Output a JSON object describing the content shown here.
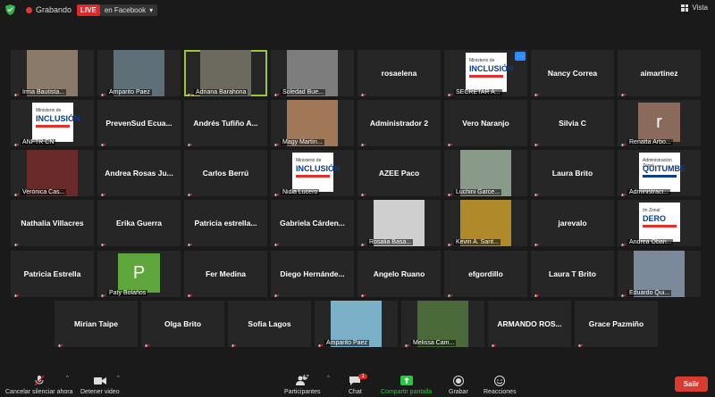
{
  "topbar": {
    "recording_label": "Grabando",
    "live_label": "LIVE",
    "live_destination": "en Facebook",
    "view_label": "Vista"
  },
  "tiles": [
    {
      "name": "Irma Bautista...",
      "style": "photo",
      "bg": "#8a7a6a"
    },
    {
      "name": "Amparito Paez",
      "style": "photo",
      "bg": "#5e6f78"
    },
    {
      "name": "Adriana Barahona",
      "style": "photo",
      "bg": "#6c6a5e",
      "active": true
    },
    {
      "name": "Soledad Bue...",
      "style": "photo",
      "bg": "#7d7d7d"
    },
    {
      "name": "rosaelena",
      "style": "text"
    },
    {
      "name": "SECRETAR A...",
      "style": "logo",
      "logo": "inclusion",
      "more": true
    },
    {
      "name": "Nancy Correa",
      "style": "text"
    },
    {
      "name": "aimartinez",
      "style": "text"
    },
    {
      "name": "ANFTR CN",
      "style": "logo",
      "logo": "inclusion"
    },
    {
      "name": "PrevenSud Ecua...",
      "style": "text"
    },
    {
      "name": "Andrés Tufiño A...",
      "style": "text"
    },
    {
      "name": "Magy Martín...",
      "style": "photo",
      "bg": "#a07858"
    },
    {
      "name": "Administrador 2",
      "style": "text"
    },
    {
      "name": "Vero Naranjo",
      "style": "text"
    },
    {
      "name": "Silvia C",
      "style": "text"
    },
    {
      "name": "Renatta Arbo...",
      "style": "letter",
      "letter": "r",
      "bg": "#8a6a5a"
    },
    {
      "name": "Verónica Cas...",
      "style": "photo",
      "bg": "#6a2a2a"
    },
    {
      "name": "Andrea Rosas Ju...",
      "style": "text"
    },
    {
      "name": "Carlos Berrú",
      "style": "text"
    },
    {
      "name": "Nidia Lucero",
      "style": "logo",
      "logo": "inclusion"
    },
    {
      "name": "AZEE Paco",
      "style": "text"
    },
    {
      "name": "Luchini Garce...",
      "style": "photo",
      "bg": "#8a9a8a"
    },
    {
      "name": "Laura Brito",
      "style": "text"
    },
    {
      "name": "Administraci...",
      "style": "logo",
      "logo": "quitumbe"
    },
    {
      "name": "Nathalia Villacres",
      "style": "text"
    },
    {
      "name": "Erika Guerra",
      "style": "text"
    },
    {
      "name": "Patricia estrella...",
      "style": "text"
    },
    {
      "name": "Gabriela Cárden...",
      "style": "text"
    },
    {
      "name": "Rosalia Basa...",
      "style": "photo",
      "bg": "#cfcfcf"
    },
    {
      "name": "Kevin A. Sant...",
      "style": "photo",
      "bg": "#b08a2a"
    },
    {
      "name": "jarevalo",
      "style": "text"
    },
    {
      "name": "Andrea Oban...",
      "style": "logo",
      "logo": "zonal"
    },
    {
      "name": "Patricia Estrella",
      "style": "text"
    },
    {
      "name": "Paty Bolaños",
      "style": "letter",
      "letter": "P",
      "bg": "#5fa63c"
    },
    {
      "name": "Fer Medina",
      "style": "text"
    },
    {
      "name": "Diego Hernánde...",
      "style": "text"
    },
    {
      "name": "Angelo Ruano",
      "style": "text"
    },
    {
      "name": "efgordillo",
      "style": "text"
    },
    {
      "name": "Laura T Brito",
      "style": "text"
    },
    {
      "name": "Eduardo Qui...",
      "style": "photo",
      "bg": "#7a8a9a"
    },
    {
      "name": "Mirian Taipe",
      "style": "text"
    },
    {
      "name": "Olga Brito",
      "style": "text"
    },
    {
      "name": "Sofia Lagos",
      "style": "text"
    },
    {
      "name": "Amparito Paez",
      "style": "photo",
      "bg": "#7ab0c8"
    },
    {
      "name": "Melissa Cam...",
      "style": "photo",
      "bg": "#4a6a3a"
    },
    {
      "name": "ARMANDO ROS...",
      "style": "text"
    },
    {
      "name": "Grace Pazmiño",
      "style": "text"
    }
  ],
  "logos": {
    "inclusion": {
      "small": "Ministerio de",
      "big": "INCLUSIÓN",
      "bar": "#e63027"
    },
    "quitumbe": {
      "small": "Administración Zonal",
      "big": "QUITUMBE",
      "bar": "#0a3d8f"
    },
    "zonal": {
      "small": "ón Zonal",
      "big": "DERO",
      "bar": "#e63027"
    }
  },
  "controls": {
    "mute_label": "Cancelar silenciar ahora",
    "video_label": "Detener video",
    "participants_label": "Participantes",
    "participants_count": "47",
    "chat_label": "Chat",
    "chat_badge": "1",
    "share_label": "Compartir pantalla",
    "record_label": "Grabar",
    "reactions_label": "Reacciones",
    "leave_label": "Salir"
  },
  "colors": {
    "share_green": "#27c840",
    "leave_red": "#d93b30",
    "active_border": "#9ac53d"
  }
}
